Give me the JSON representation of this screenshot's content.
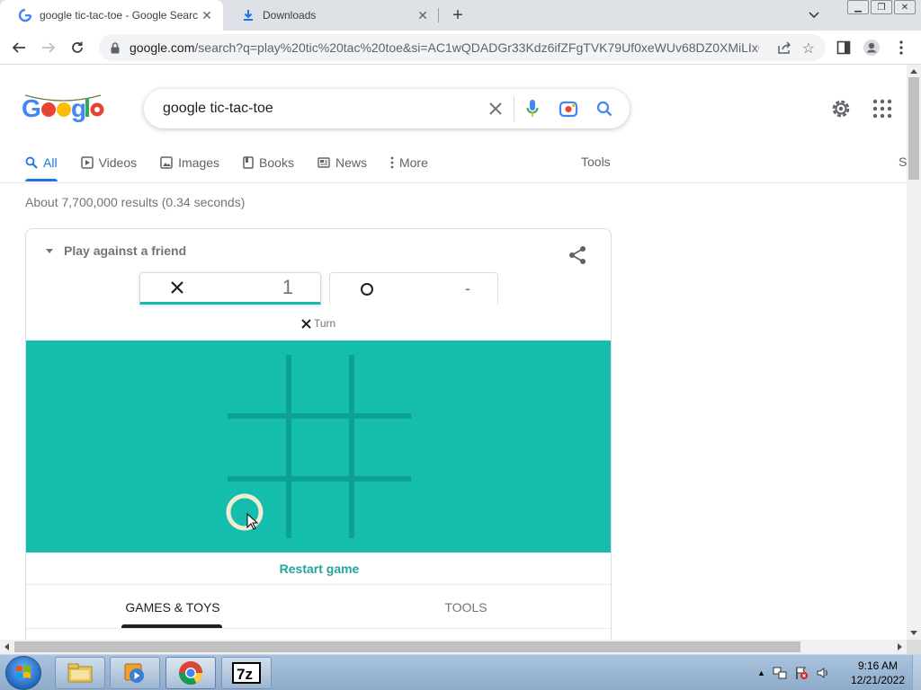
{
  "browser": {
    "tabs": [
      {
        "title": "google tic-tac-toe - Google Search",
        "favicon": "google-favicon",
        "active": true
      },
      {
        "title": "Downloads",
        "favicon": "download-icon",
        "active": false
      }
    ],
    "url_host": "google.com",
    "url_path": "/search?q=play%20tic%20tac%20toe&si=AC1wQDADGr33Kdz6ifZFgTVK79Uf0xeWUv68DZ0XMiLIxC..."
  },
  "search": {
    "query": "google tic-tac-toe",
    "nav": [
      {
        "label": "All",
        "icon": "search-icon"
      },
      {
        "label": "Videos",
        "icon": "video-icon"
      },
      {
        "label": "Images",
        "icon": "image-icon"
      },
      {
        "label": "Books",
        "icon": "book-icon"
      },
      {
        "label": "News",
        "icon": "news-icon"
      },
      {
        "label": "More",
        "icon": "more-vert-icon"
      }
    ],
    "tools": "Tools",
    "nav_cut": "S",
    "result_stats": "About 7,700,000 results (0.34 seconds)"
  },
  "game": {
    "mode": "Play against a friend",
    "x_score": "1",
    "o_score": "-",
    "turn_label": "Turn",
    "turn_player": "X",
    "board": [
      "",
      "",
      "",
      "",
      "",
      "",
      "O",
      "",
      ""
    ],
    "restart": "Restart game",
    "tabs": [
      {
        "label": "GAMES & TOYS",
        "active": true
      },
      {
        "label": "TOOLS",
        "active": false
      }
    ],
    "colors": {
      "board": "#14bdac",
      "grid": "#0da192",
      "o_mark": "#f2ebd3",
      "x_mark": "#545454"
    }
  },
  "taskbar": {
    "apps": [
      "file-explorer-icon",
      "media-player-icon",
      "chrome-icon",
      "7zip-icon"
    ],
    "time": "9:16 AM",
    "date": "12/21/2022"
  }
}
